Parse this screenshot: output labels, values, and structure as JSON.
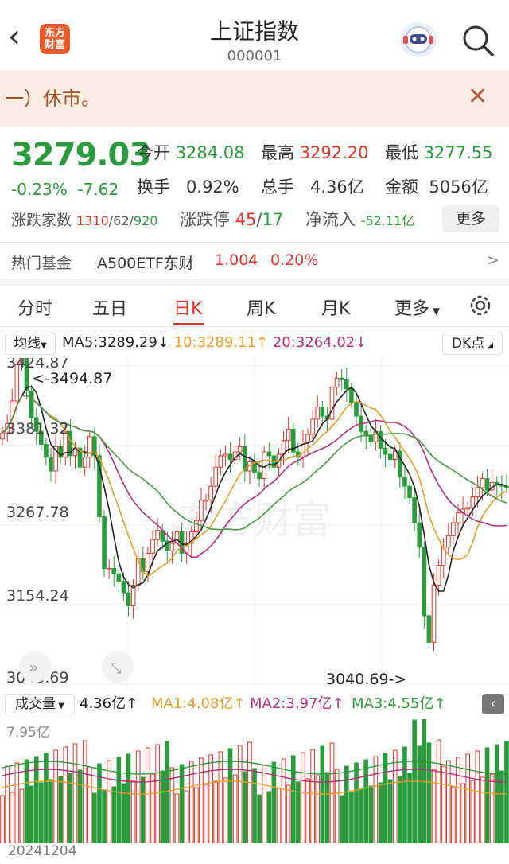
{
  "header": {
    "title": "上证指数",
    "code": "000001",
    "logo_text": "东方财富",
    "back_icon": "‹"
  },
  "notice": {
    "text": "一）休市。"
  },
  "quote": {
    "price": "3279.03",
    "change_pct": "-0.23%",
    "change": "-7.62",
    "open_label": "今开",
    "open": "3284.08",
    "high_label": "最高",
    "high": "3292.20",
    "low_label": "最低",
    "low": "3277.55",
    "turnover_label": "换手",
    "turnover": "0.92%",
    "vol_label": "总手",
    "vol": "4.36亿",
    "amount_label": "金额",
    "amount": "5056亿",
    "adv_label": "涨跌家数",
    "adv_up": "1310",
    "adv_flat": "62",
    "adv_down": "920",
    "limit_label": "涨跌停",
    "limit_up": "45",
    "limit_down": "17",
    "inflow_label": "净流入",
    "inflow": "-52.11亿",
    "more": "更多"
  },
  "fund": {
    "label": "热门基金",
    "name": "A500ETF东财",
    "price": "1.004",
    "pct": "0.20%",
    "arrow": ">"
  },
  "tabs": [
    "分时",
    "五日",
    "日K",
    "周K",
    "月K",
    "更多"
  ],
  "active_tab": 2,
  "ma": {
    "select": "均线",
    "ma5": "MA5:3289.29↓",
    "ma10": "10:3289.11↑",
    "ma20": "20:3264.02↓",
    "dk": "DK点"
  },
  "chart_data": {
    "type": "candlestick",
    "y_labels": [
      "3424.87",
      "3381.32",
      "3267.78",
      "3154.24",
      "3040.69"
    ],
    "high_annot": "3494.87",
    "low_annot": "3040.69->",
    "watermark": "东方财富",
    "closes": [
      3350,
      3362,
      3392,
      3440,
      3448,
      3405,
      3370,
      3352,
      3335,
      3318,
      3300,
      3332,
      3318,
      3352,
      3320,
      3330,
      3305,
      3318,
      3345,
      3320,
      3240,
      3172,
      3172,
      3165,
      3155,
      3140,
      3123,
      3150,
      3185,
      3168,
      3192,
      3210,
      3222,
      3208,
      3195,
      3205,
      3220,
      3192,
      3205,
      3220,
      3235,
      3262,
      3262,
      3280,
      3305,
      3320,
      3322,
      3315,
      3325,
      3332,
      3300,
      3312,
      3298,
      3290,
      3325,
      3320,
      3305,
      3322,
      3340,
      3355,
      3325,
      3318,
      3338,
      3348,
      3368,
      3384,
      3372,
      3368,
      3410,
      3422,
      3420,
      3408,
      3390,
      3372,
      3352,
      3346,
      3338,
      3352,
      3330,
      3322,
      3315,
      3326,
      3292,
      3280,
      3265,
      3232,
      3200,
      3110,
      3075,
      3150,
      3176,
      3200,
      3215,
      3232,
      3245,
      3250,
      3252,
      3266,
      3278,
      3290,
      3275,
      3285,
      3282,
      3280,
      3279
    ]
  },
  "volume": {
    "select": "成交量",
    "value": "4.36亿↑",
    "ma1": "MA1:4.08亿↑",
    "ma2": "MA2:3.97亿↑",
    "ma3": "MA3:4.55亿↑",
    "axis": "7.95亿"
  },
  "date": "20241204",
  "colors": {
    "up": "#d8362b",
    "down": "#2a9a3c",
    "ma5": "#222222",
    "ma10": "#e0a030",
    "ma20": "#b0307a",
    "ma30": "#4a9a4a"
  }
}
